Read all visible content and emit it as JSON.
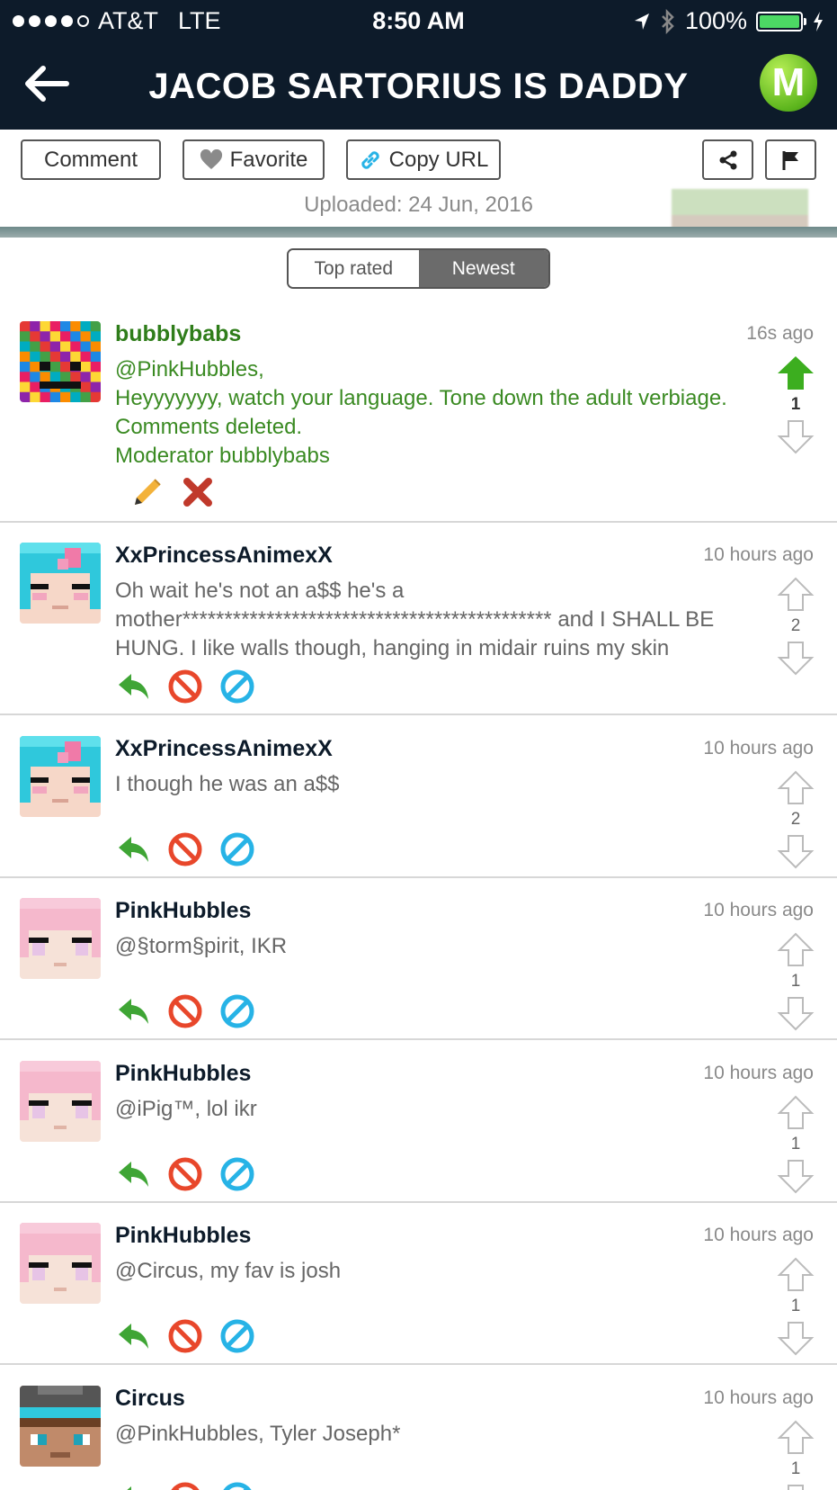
{
  "status_bar": {
    "carrier": "AT&T",
    "network": "LTE",
    "time": "8:50 AM",
    "battery": "100%"
  },
  "nav": {
    "title": "JACOB SARTORIUS IS DADDY",
    "logo_letter": "M"
  },
  "toolbar": {
    "comment_label": "Comment",
    "favorite_label": "Favorite",
    "copy_url_label": "Copy URL",
    "uploaded": "Uploaded: 24 Jun, 2016"
  },
  "sort": {
    "top_rated": "Top rated",
    "newest": "Newest",
    "selected": "Newest"
  },
  "colors": {
    "nav_bg": "#0d1b2a",
    "moderator_green": "#3a8a22",
    "upvote_green": "#3cae1f",
    "reply_green": "#3fa535",
    "report_red": "#e8472b",
    "block_blue": "#27b3e6"
  },
  "comments": [
    {
      "user": "bubblybabs",
      "time": "16s ago",
      "lines": [
        "@PinkHubbles,",
        "Heyyyyyyy, watch your language. Tone down the adult verbiage. Comments deleted.",
        "Moderator bubblybabs"
      ],
      "votes": "1",
      "moderator": true,
      "avatar": "rainbow-avatar",
      "actions": [
        "edit-icon",
        "delete-icon"
      ]
    },
    {
      "user": "XxPrincessAnimexX",
      "time": "10 hours ago",
      "lines": [
        "Oh wait he's not an a$$ he's a mother******************************************** and I SHALL BE HUNG. I like walls though, hanging in midair ruins my skin"
      ],
      "votes": "2",
      "moderator": false,
      "avatar": "cyan-pink-hair-avatar",
      "actions": [
        "reply-icon",
        "report-icon",
        "block-icon"
      ]
    },
    {
      "user": "XxPrincessAnimexX",
      "time": "10 hours ago",
      "lines": [
        "I though he was an a$$"
      ],
      "votes": "2",
      "moderator": false,
      "avatar": "cyan-pink-hair-avatar",
      "actions": [
        "reply-icon",
        "report-icon",
        "block-icon"
      ]
    },
    {
      "user": "PinkHubbles",
      "time": "10 hours ago",
      "lines": [
        "@§torm§pirit, IKR"
      ],
      "votes": "1",
      "moderator": false,
      "avatar": "pink-hair-avatar",
      "actions": [
        "reply-icon",
        "report-icon",
        "block-icon"
      ]
    },
    {
      "user": "PinkHubbles",
      "time": "10 hours ago",
      "lines": [
        "@iPig™, lol ikr"
      ],
      "votes": "1",
      "moderator": false,
      "avatar": "pink-hair-avatar",
      "actions": [
        "reply-icon",
        "report-icon",
        "block-icon"
      ]
    },
    {
      "user": "PinkHubbles",
      "time": "10 hours ago",
      "lines": [
        "@Circus, my fav is josh"
      ],
      "votes": "1",
      "moderator": false,
      "avatar": "pink-hair-avatar",
      "actions": [
        "reply-icon",
        "report-icon",
        "block-icon"
      ]
    },
    {
      "user": "Circus",
      "time": "10 hours ago",
      "lines": [
        "@PinkHubbles, Tyler Joseph*"
      ],
      "votes": "1",
      "moderator": false,
      "avatar": "grey-hat-avatar",
      "actions": [
        "reply-icon",
        "report-icon",
        "block-icon"
      ]
    }
  ]
}
